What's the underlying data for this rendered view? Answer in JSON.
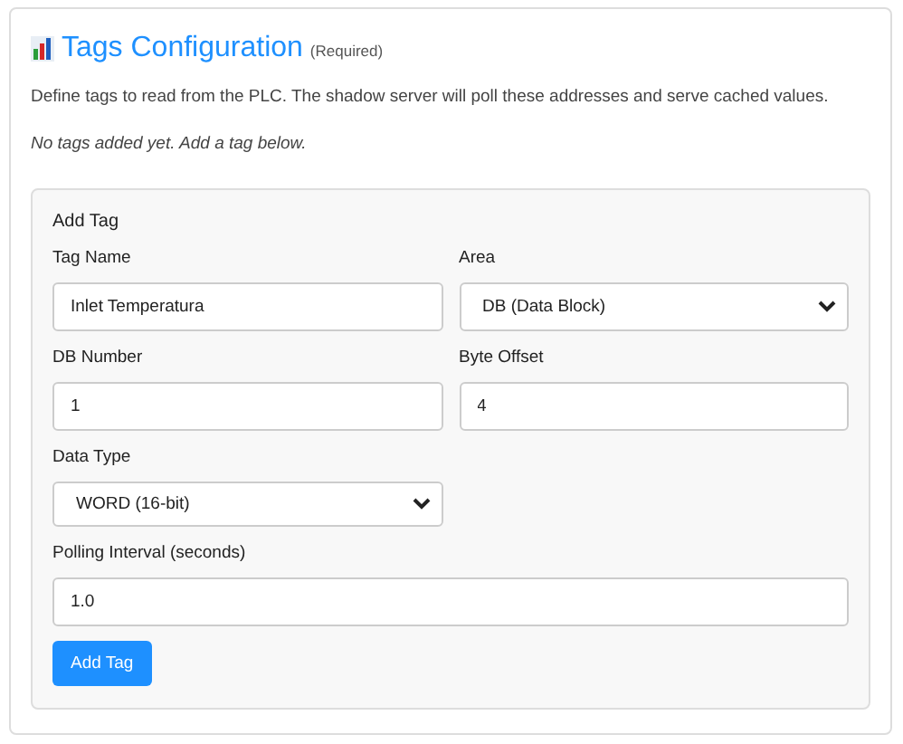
{
  "section": {
    "title": "Tags Configuration",
    "badge": "(Required)",
    "description": "Define tags to read from the PLC. The shadow server will poll these addresses and serve cached values.",
    "empty_message": "No tags added yet. Add a tag below."
  },
  "add_tag": {
    "heading": "Add Tag",
    "rows": [
      [
        {
          "kind": "text",
          "label": "Tag Name",
          "value": "Inlet Temperatura"
        },
        {
          "kind": "select",
          "label": "Area",
          "value": "DB (Data Block)"
        }
      ],
      [
        {
          "kind": "text",
          "label": "DB Number",
          "value": "1"
        },
        {
          "kind": "text",
          "label": "Byte Offset",
          "value": "4"
        }
      ],
      [
        {
          "kind": "select",
          "label": "Data Type",
          "value": "WORD (16-bit)"
        }
      ],
      [
        {
          "kind": "text",
          "label": "Polling Interval (seconds)",
          "value": "1.0"
        }
      ]
    ],
    "button": "Add Tag"
  }
}
